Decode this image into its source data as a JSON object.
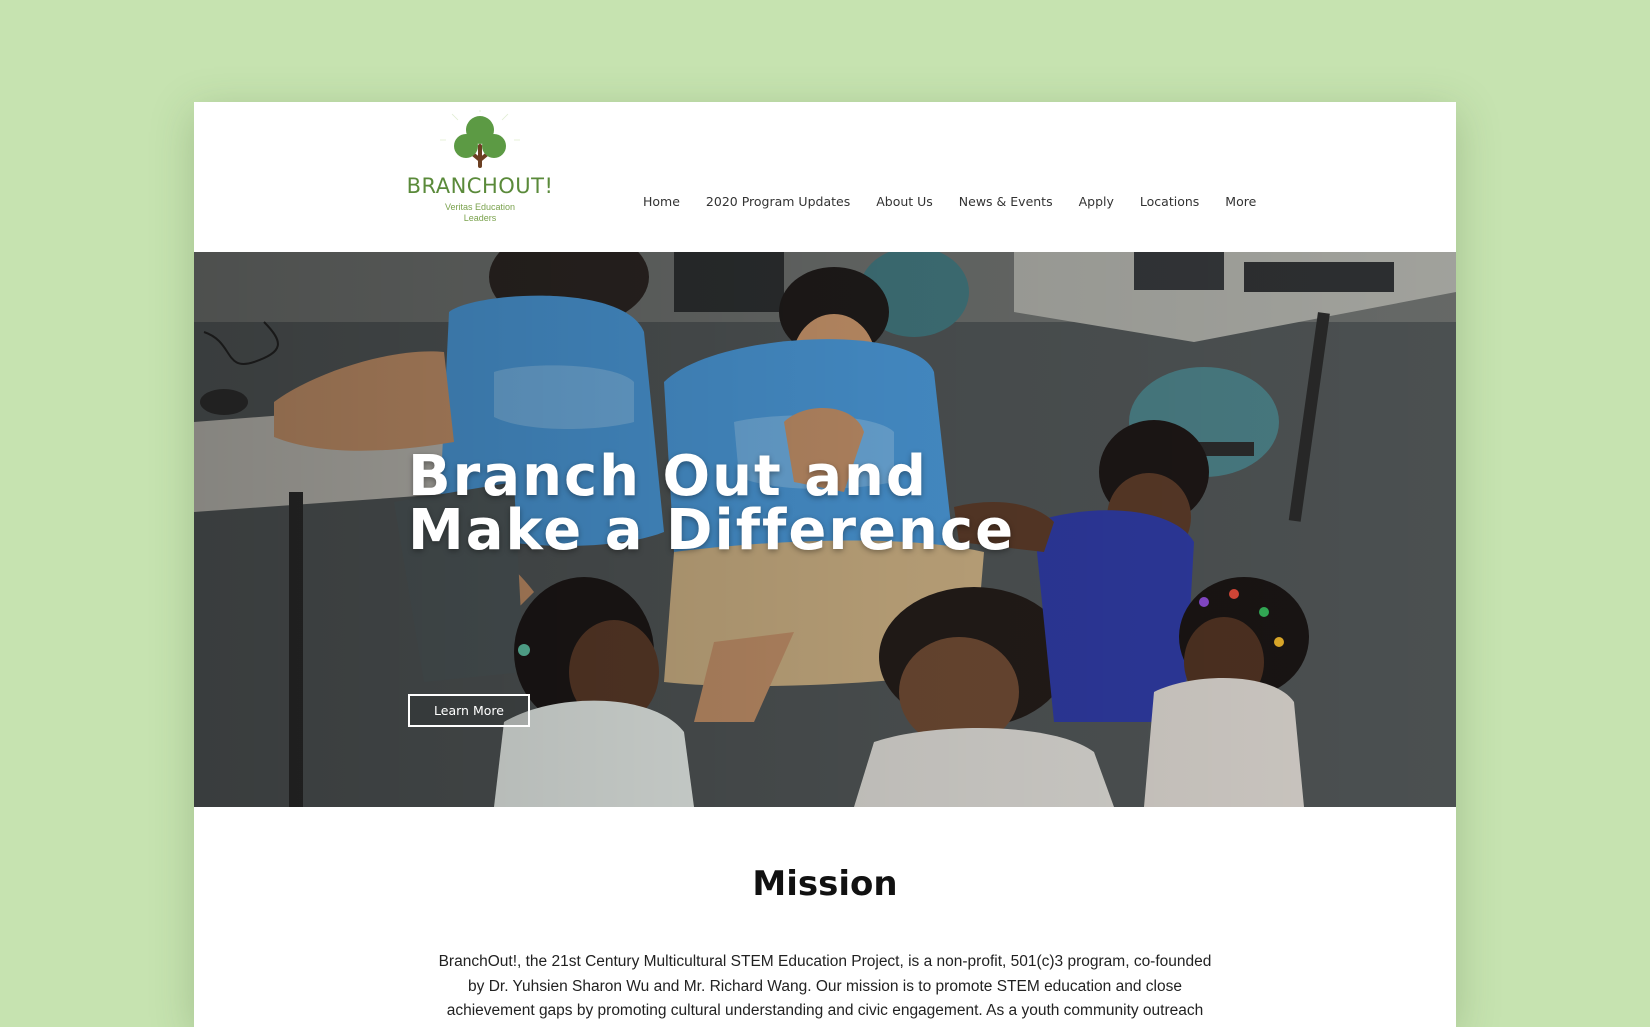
{
  "logo": {
    "icon": "tree-icon",
    "title": "BRANCHOUT!",
    "subtitle": "Veritas Education Leaders"
  },
  "nav": {
    "items": [
      {
        "label": "Home"
      },
      {
        "label": "2020 Program Updates"
      },
      {
        "label": "About Us"
      },
      {
        "label": "News & Events"
      },
      {
        "label": "Apply"
      },
      {
        "label": "Locations"
      },
      {
        "label": "More"
      }
    ]
  },
  "hero": {
    "title": "Branch Out and Make a Difference",
    "button_label": "Learn More"
  },
  "mission": {
    "title": "Mission",
    "text": "BranchOut!, the 21st Century Multicultural STEM Education Project, is a non-profit, 501(c)3 program, co-founded by Dr. Yuhsien Sharon Wu and Mr. Richard Wang. Our mission is to promote STEM education and close achievement gaps by promoting cultural understanding and civic engagement. As a youth community outreach"
  },
  "colors": {
    "page_background": "#c6e3b0",
    "brand_green": "#5a8a3a",
    "shirt_blue": "#4a97d6"
  }
}
